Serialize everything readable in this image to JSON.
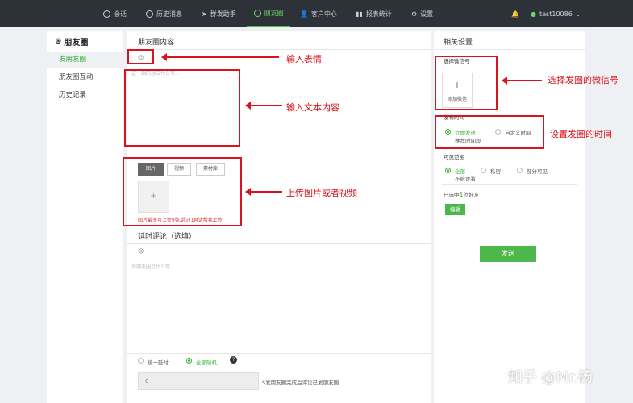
{
  "nav": {
    "items": [
      {
        "label": "会话",
        "icon": "chat-icon"
      },
      {
        "label": "历史消息",
        "icon": "clock-icon"
      },
      {
        "label": "群发助手",
        "icon": "send-icon"
      },
      {
        "label": "朋友圈",
        "icon": "moments-icon"
      },
      {
        "label": "客户中心",
        "icon": "user-icon"
      },
      {
        "label": "报表统计",
        "icon": "bar-chart-icon"
      },
      {
        "label": "设置",
        "icon": "gear-icon"
      }
    ],
    "active_index": 3,
    "username": "test10086"
  },
  "sidebar": {
    "title": "朋友圈",
    "items": [
      {
        "label": "发朋友圈"
      },
      {
        "label": "朋友圈互动"
      },
      {
        "label": "历史记录"
      }
    ],
    "active_index": 0
  },
  "main": {
    "title": "朋友圈内容",
    "text_placeholder": "这一刻的想法什么写...",
    "tabs": [
      {
        "label": "图片"
      },
      {
        "label": "视频"
      },
      {
        "label": "素材库"
      }
    ],
    "upload_plus": "+",
    "upload_hint": "图片最多可上传9张,超过1M请帮我上传",
    "comment_title": "延时评论（选填）",
    "comment_placeholder": "说朋友圈点什么写...",
    "delay_options": [
      {
        "label": "统一延时"
      },
      {
        "label": "全部随机"
      }
    ],
    "delay_value": "0",
    "delay_suffix": "S发朋友圈完成后评论已发朋友圈"
  },
  "right": {
    "title": "相关设置",
    "wechat_label": "选择微信号",
    "add_plus": "+",
    "add_label": "添加微信",
    "time_label": "发布时间",
    "time_options": [
      {
        "label": "立即发送"
      },
      {
        "label": "自定义时间"
      },
      {
        "label": "推荐时间段"
      }
    ],
    "visible_label": "可见范围",
    "visible_options": [
      {
        "label": "全部"
      },
      {
        "label": "私密"
      },
      {
        "label": "部分可见"
      },
      {
        "label": "不给谁看"
      }
    ],
    "selected_prefix": "已选中",
    "selected_count": "1",
    "selected_suffix": "位好友",
    "edit_button": "编辑",
    "send_button": "发送"
  },
  "annotations": {
    "emoji": "输入表情",
    "text": "输入文本内容",
    "upload": "上传图片或者视频",
    "wechat": "选择发圈的微信号",
    "time": "设置发圈的时间"
  },
  "watermark": "知乎 @Mr.杨",
  "colors": {
    "accent": "#4cb84c",
    "annotation": "#d8141c",
    "topbar": "#2d3238"
  }
}
